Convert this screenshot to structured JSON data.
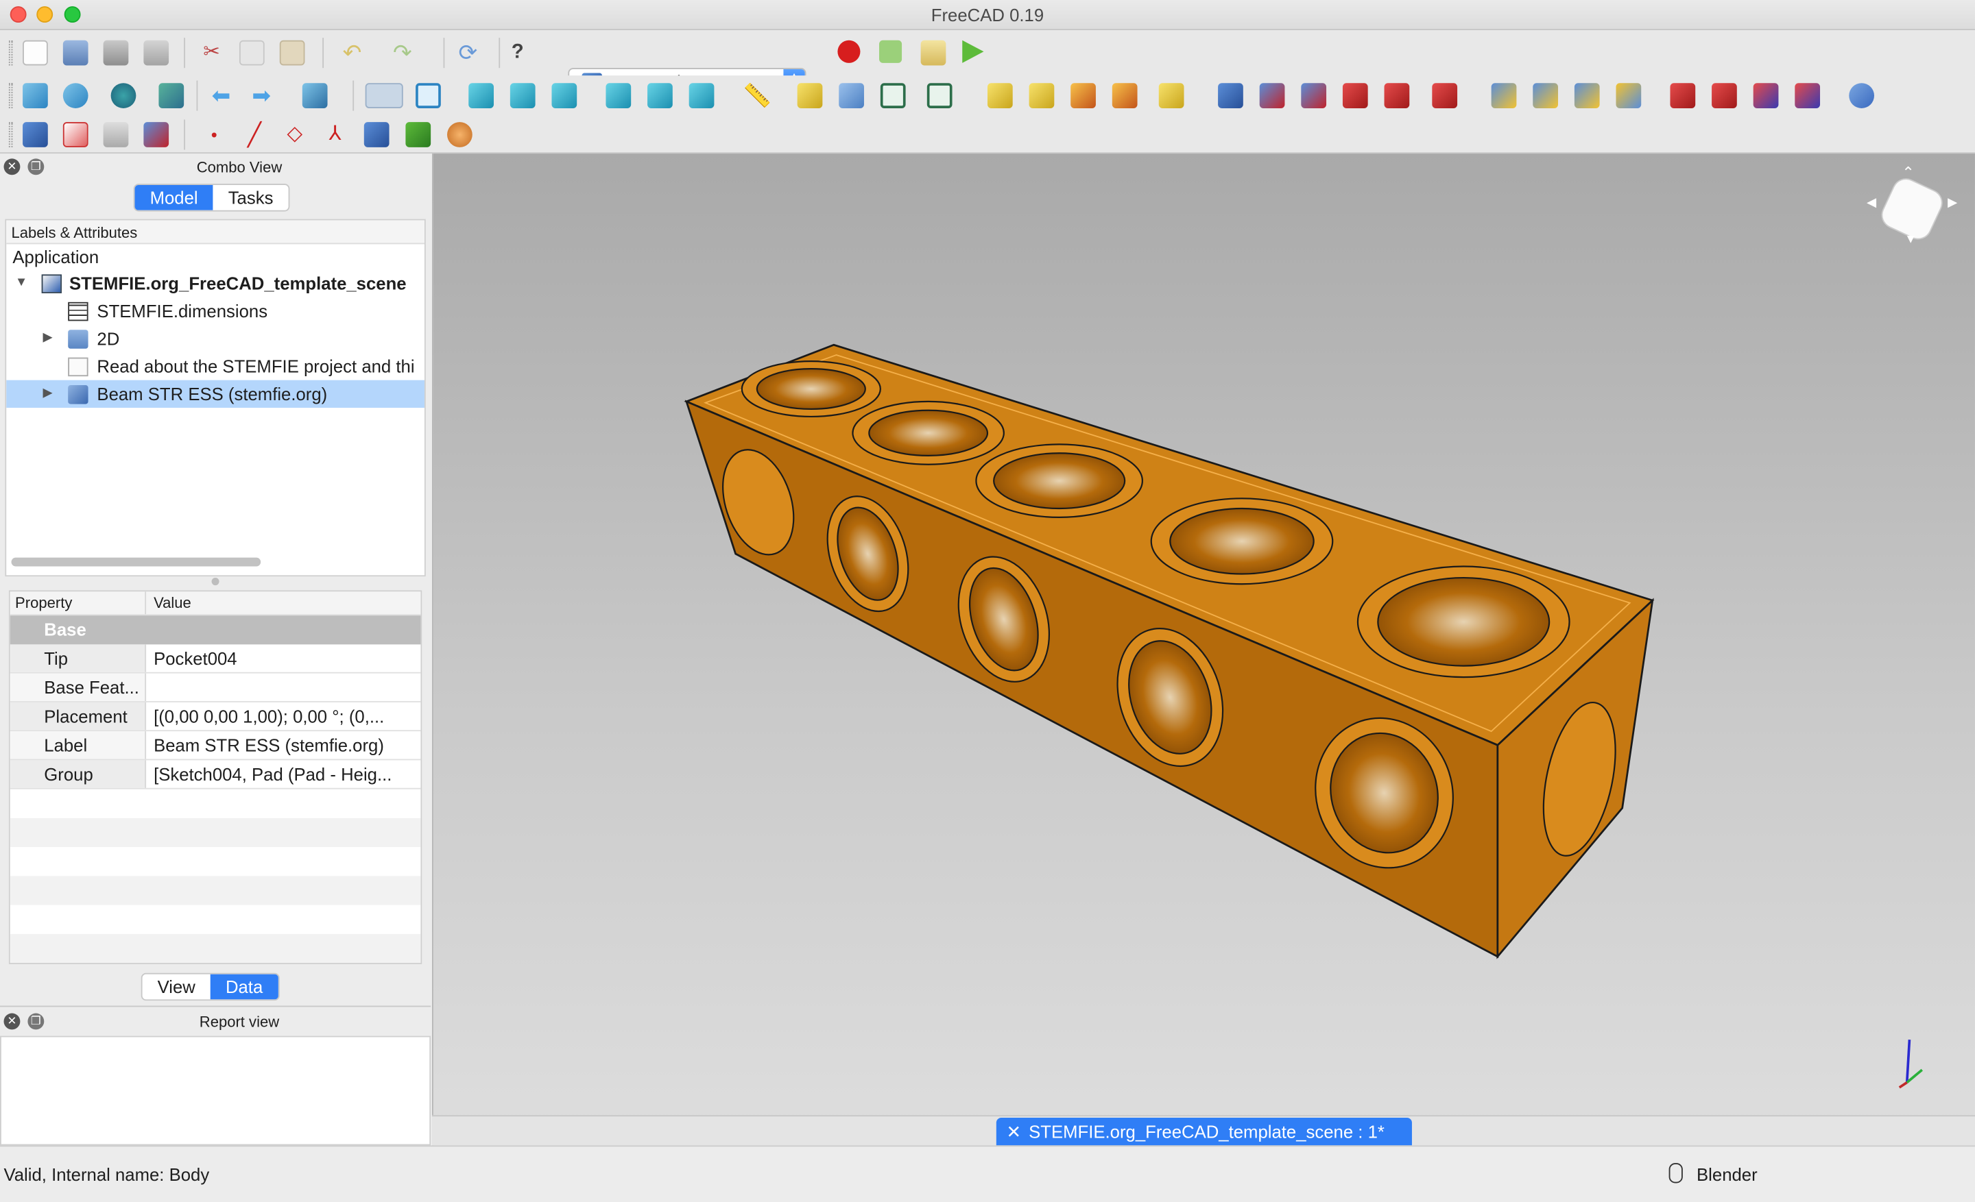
{
  "window": {
    "title": "FreeCAD 0.19"
  },
  "toolbar": {
    "workbench_label": "Part Design"
  },
  "combo_view": {
    "title": "Combo View",
    "tabs": [
      {
        "label": "Model",
        "active": true
      },
      {
        "label": "Tasks",
        "active": false
      }
    ],
    "tree_header": "Labels & Attributes",
    "tree": {
      "application_label": "Application",
      "items": [
        {
          "label": "STEMFIE.org_FreeCAD_template_scene",
          "level": 0,
          "expanded": true,
          "bold": true,
          "icon": "document-icon"
        },
        {
          "label": "STEMFIE.dimensions",
          "level": 1,
          "icon": "spreadsheet-icon"
        },
        {
          "label": "2D",
          "level": 1,
          "expandable": true,
          "icon": "folder-icon"
        },
        {
          "label": "Read about the STEMFIE project and thi",
          "level": 1,
          "icon": "text-document-icon"
        },
        {
          "label": "Beam STR ESS (stemfie.org)",
          "level": 1,
          "expandable": true,
          "selected": true,
          "icon": "body-icon"
        }
      ]
    },
    "property_table": {
      "col_property": "Property",
      "col_value": "Value",
      "group": "Base",
      "rows": [
        {
          "name": "Tip",
          "value": "Pocket004"
        },
        {
          "name": "Base Feat...",
          "value": ""
        },
        {
          "name": "Placement",
          "value": "[(0,00 0,00 1,00); 0,00 °; (0,...",
          "expandable": true
        },
        {
          "name": "Label",
          "value": "Beam STR ESS (stemfie.org)"
        },
        {
          "name": "Group",
          "value": "[Sketch004, Pad (Pad - Heig..."
        }
      ]
    },
    "bottom_tabs": [
      {
        "label": "View",
        "active": false
      },
      {
        "label": "Data",
        "active": true
      }
    ]
  },
  "report_view": {
    "title": "Report view"
  },
  "document_tab": {
    "label": "STEMFIE.org_FreeCAD_template_scene : 1*"
  },
  "status": {
    "message": "Valid, Internal name: Body",
    "navigation_style": "Blender"
  },
  "colors": {
    "accent": "#2f7ef6",
    "model_orange": "#c97a12",
    "selection": "#b4d6fc"
  }
}
